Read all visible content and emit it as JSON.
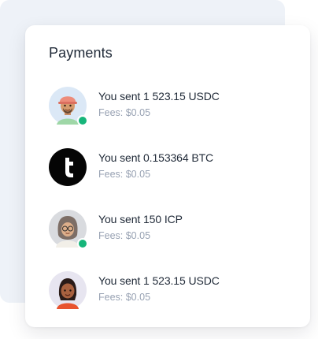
{
  "payments": {
    "title": "Payments",
    "items": [
      {
        "title": "You sent 1 523.15 USDC",
        "fee": "Fees: $0.05",
        "avatar_icon": "man-cap-avatar-icon",
        "online": true
      },
      {
        "title": "You sent 0.153364 BTC",
        "fee": "Fees: $0.05",
        "avatar_icon": "t-logo-icon",
        "online": false
      },
      {
        "title": "You sent 150 ICP",
        "fee": "Fees: $0.05",
        "avatar_icon": "woman-hijab-avatar-icon",
        "online": true
      },
      {
        "title": "You sent 1 523.15 USDC",
        "fee": "Fees: $0.05",
        "avatar_icon": "woman-avatar-icon",
        "online": false
      }
    ]
  },
  "colors": {
    "online": "#16b57a",
    "background_panel": "#eef2f8",
    "title": "#1f2937",
    "muted": "#98a2b3"
  }
}
